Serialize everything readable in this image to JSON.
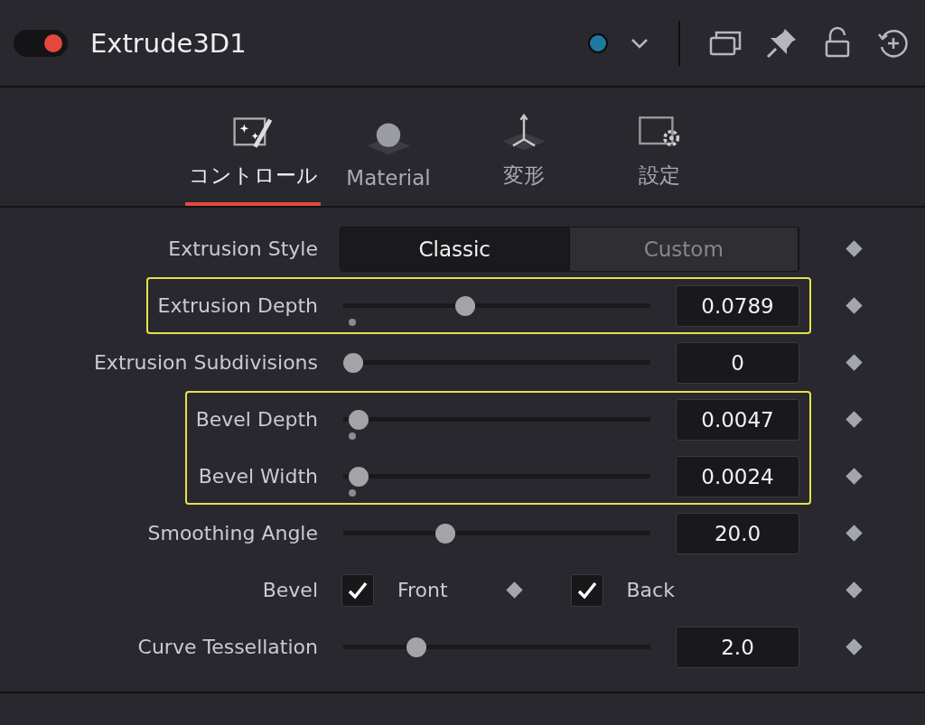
{
  "header": {
    "enabled": true,
    "title": "Extrude3D1",
    "color": "#1f7aa0"
  },
  "tabs": [
    {
      "label": "コントロール",
      "kind": "controls",
      "selected": true
    },
    {
      "label": "Material",
      "kind": "material",
      "selected": false
    },
    {
      "label": "変形",
      "kind": "transform",
      "selected": false
    },
    {
      "label": "設定",
      "kind": "settings",
      "selected": false
    }
  ],
  "groups": [
    {
      "highlighted": false,
      "rows": [
        {
          "kind": "segmented",
          "label": "Extrusion Style",
          "options": [
            {
              "label": "Classic",
              "selected": true
            },
            {
              "label": "Custom",
              "selected": false
            }
          ]
        }
      ]
    },
    {
      "highlighted": true,
      "rows": [
        {
          "kind": "slider",
          "label": "Extrusion Depth",
          "level": 0.39,
          "value": "0.0789",
          "default_marker": true
        }
      ]
    },
    {
      "highlighted": false,
      "rows": [
        {
          "kind": "slider",
          "label": "Extrusion Subdivisions",
          "level": 0,
          "value": "0",
          "default_marker": false
        }
      ]
    },
    {
      "highlighted": true,
      "rows": [
        {
          "kind": "slider",
          "label": "Bevel Depth",
          "level": 0.02,
          "value": "0.0047",
          "default_marker": true
        },
        {
          "kind": "slider",
          "label": "Bevel Width",
          "level": 0.02,
          "value": "0.0024",
          "default_marker": true
        }
      ]
    },
    {
      "highlighted": false,
      "rows": [
        {
          "kind": "slider",
          "label": "Smoothing Angle",
          "level": 0.32,
          "value": "20.0",
          "default_marker": false
        },
        {
          "kind": "checkboxes",
          "label": "Bevel",
          "options": [
            {
              "label": "Front",
              "checked": true
            },
            {
              "label": "Back",
              "checked": true
            }
          ]
        },
        {
          "kind": "slider",
          "label": "Curve Tessellation",
          "level": 0.22,
          "value": "2.0",
          "default_marker": false
        }
      ]
    }
  ]
}
